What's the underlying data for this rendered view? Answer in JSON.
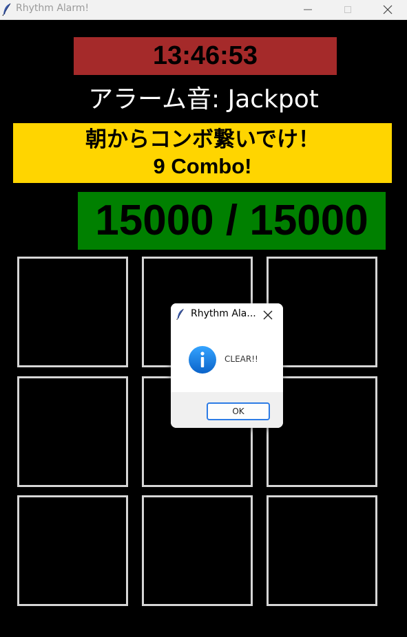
{
  "window": {
    "title": "Rhythm Alarm!",
    "controls": {
      "minimize": "minimize",
      "maximize": "maximize",
      "close": "close"
    }
  },
  "clock": {
    "time": "13:46:53",
    "background": "#a52a2a"
  },
  "alarm_sound": {
    "text": "アラーム音: Jackpot"
  },
  "combo": {
    "message": "朝からコンボ繋いでけ！",
    "count_text": "9 Combo!",
    "background": "#ffd500"
  },
  "score": {
    "text": "15000 / 15000",
    "background": "#008000"
  },
  "grid": {
    "rows": 3,
    "cols": 3,
    "tiles": [
      "tile-1",
      "tile-2",
      "tile-3",
      "tile-4",
      "tile-5",
      "tile-6",
      "tile-7",
      "tile-8",
      "tile-9"
    ]
  },
  "dialog": {
    "title": "Rhythm Ala...",
    "icon": "info-icon",
    "message": "CLEAR!!",
    "ok_label": "OK"
  }
}
